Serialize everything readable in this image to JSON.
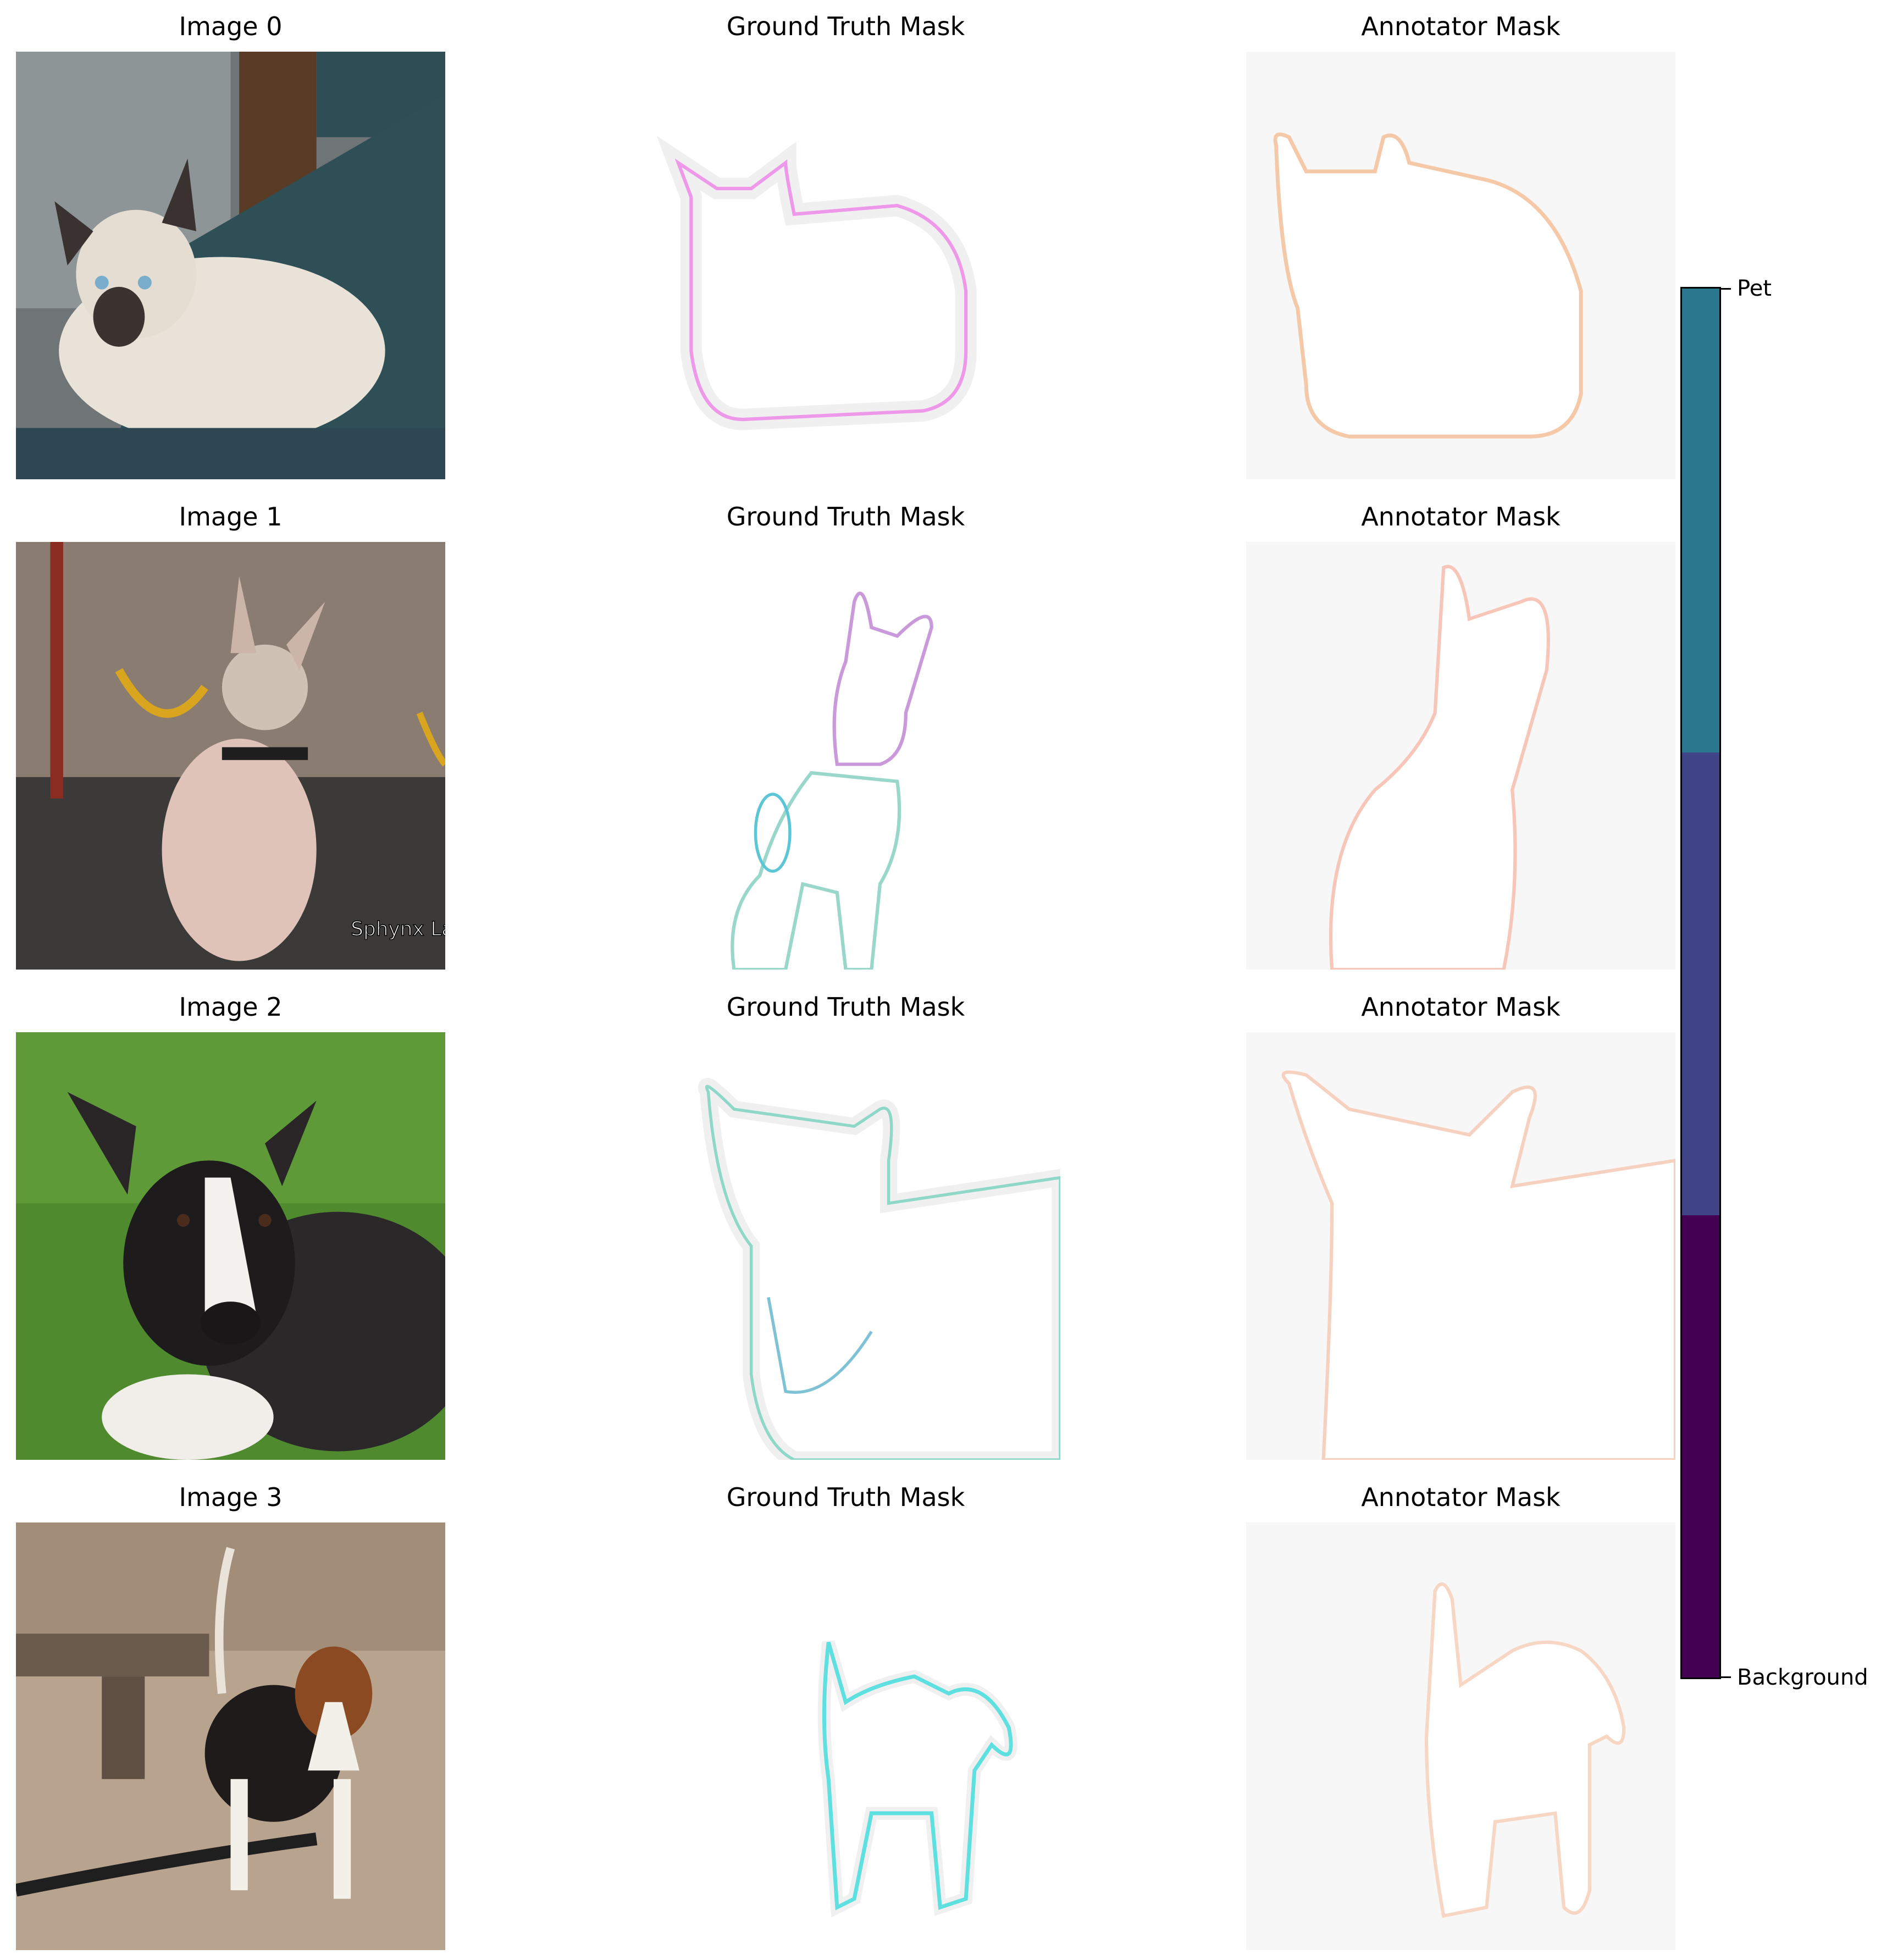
{
  "rows": [
    {
      "image_title": "Image 0",
      "gt_title": "Ground Truth Mask",
      "ann_title": "Annotator Mask",
      "subject": "cat"
    },
    {
      "image_title": "Image 1",
      "gt_title": "Ground Truth Mask",
      "ann_title": "Annotator Mask",
      "subject": "cat",
      "watermark": "Sphynx Lair"
    },
    {
      "image_title": "Image 2",
      "gt_title": "Ground Truth Mask",
      "ann_title": "Annotator Mask",
      "subject": "dog"
    },
    {
      "image_title": "Image 3",
      "gt_title": "Ground Truth Mask",
      "ann_title": "Annotator Mask",
      "subject": "dog"
    }
  ],
  "colorbar": {
    "top_label": "Pet",
    "bottom_label": "Background",
    "colors": [
      "#2a788e",
      "#414487",
      "#440154"
    ]
  }
}
